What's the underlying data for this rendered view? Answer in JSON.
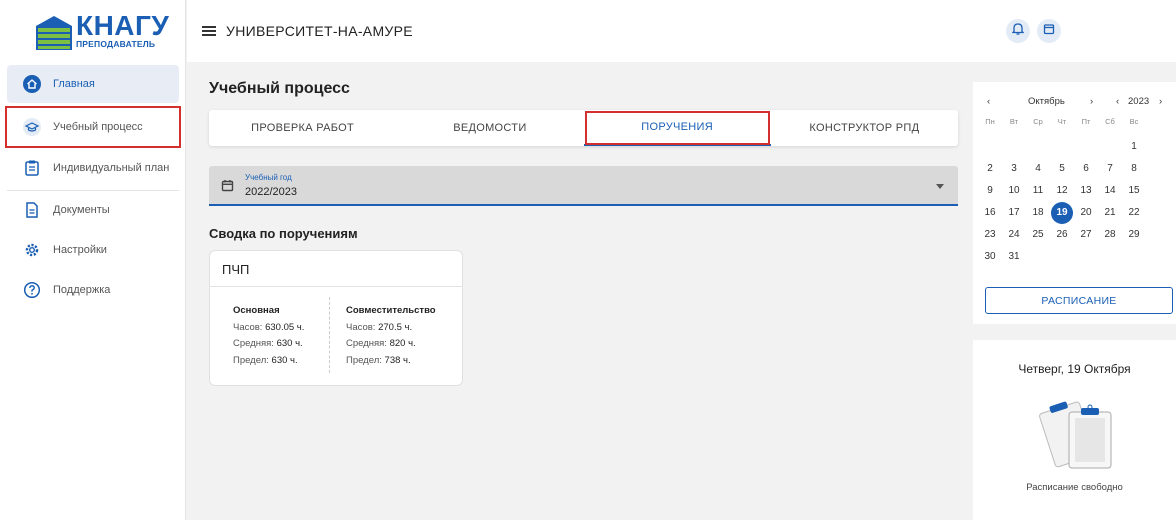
{
  "app": {
    "logo_text": "КНАГУ",
    "logo_sub": "ПРЕПОДАВАТЕЛЬ",
    "title": "УНИВЕРСИТЕТ-НА-АМУРЕ"
  },
  "sidebar": {
    "items": [
      {
        "label": "Главная",
        "icon": "home-icon"
      },
      {
        "label": "Учебный процесс",
        "icon": "graduation-cap-icon"
      },
      {
        "label": "Индивидуальный план",
        "icon": "plan-icon"
      },
      {
        "label": "Документы",
        "icon": "document-icon"
      },
      {
        "label": "Настройки",
        "icon": "gear-icon"
      },
      {
        "label": "Поддержка",
        "icon": "help-icon"
      }
    ]
  },
  "main": {
    "title": "Учебный процесс",
    "tabs": [
      {
        "label": "ПРОВЕРКА РАБОТ"
      },
      {
        "label": "ВЕДОМОСТИ"
      },
      {
        "label": "ПОРУЧЕНИЯ"
      },
      {
        "label": "КОНСТРУКТОР РПД"
      }
    ],
    "year_select": {
      "label": "Учебный год",
      "value": "2022/2023"
    },
    "summary_title": "Сводка по поручениям",
    "card": {
      "title": "ПЧП",
      "main": {
        "heading": "Основная",
        "hours_label": "Часов: ",
        "hours": "630.05 ч.",
        "avg_label": "Средняя: ",
        "avg": "630 ч.",
        "limit_label": "Предел: ",
        "limit": "630 ч."
      },
      "part_time": {
        "heading": "Совместительство",
        "hours_label": "Часов: ",
        "hours": "270.5 ч.",
        "avg_label": "Средняя: ",
        "avg": "820 ч.",
        "limit_label": "Предел: ",
        "limit": "738 ч."
      }
    }
  },
  "calendar": {
    "prev": "‹",
    "month": "Октябрь",
    "next": "›",
    "year_prev": "‹",
    "year": "2023",
    "year_next": "›",
    "weekdays": [
      "Пн",
      "Вт",
      "Ср",
      "Чт",
      "Пт",
      "Сб",
      "Вс"
    ],
    "first_weekday_index": 6,
    "days_in_month": 31,
    "today": 19,
    "schedule_button": "РАСПИСАНИЕ"
  },
  "day": {
    "title": "Четверг, 19 Октября",
    "status": "Расписание свободно"
  },
  "colors": {
    "accent": "#1a5fb4",
    "highlight": "#d32f2f"
  }
}
